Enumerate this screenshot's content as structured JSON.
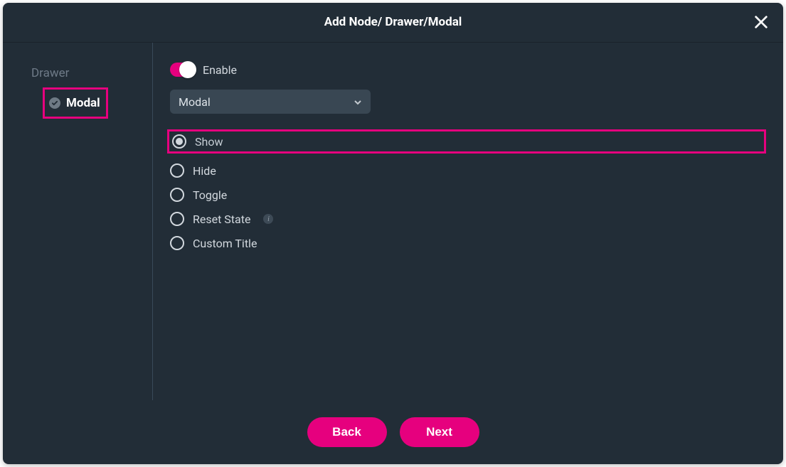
{
  "header": {
    "title": "Add Node/ Drawer/Modal"
  },
  "sidebar": {
    "items": [
      {
        "label": "Drawer",
        "current": false
      },
      {
        "label": "Modal",
        "current": true
      }
    ]
  },
  "main": {
    "enable_label": "Enable",
    "select_value": "Modal",
    "options": [
      {
        "label": "Show",
        "selected": true,
        "highlight": true,
        "info": false
      },
      {
        "label": "Hide",
        "selected": false,
        "highlight": false,
        "info": false
      },
      {
        "label": "Toggle",
        "selected": false,
        "highlight": false,
        "info": false
      },
      {
        "label": "Reset State",
        "selected": false,
        "highlight": false,
        "info": true
      },
      {
        "label": "Custom Title",
        "selected": false,
        "highlight": false,
        "info": false
      }
    ],
    "info_glyph": "i"
  },
  "footer": {
    "back": "Back",
    "next": "Next"
  }
}
